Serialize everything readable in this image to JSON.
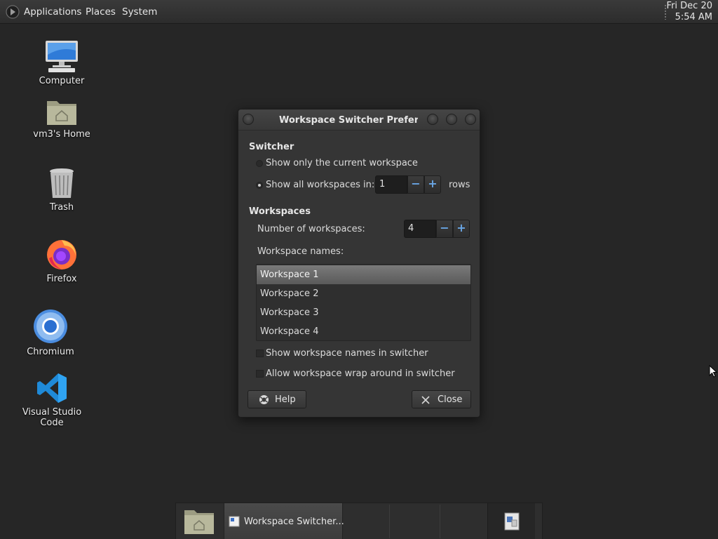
{
  "top_panel": {
    "menus": [
      "Applications",
      "Places",
      "System"
    ],
    "clock": {
      "day_date": "Fri Dec 20",
      "time": "5:54 AM"
    }
  },
  "desktop_icons": [
    {
      "label": "Computer",
      "icon": "computer-icon"
    },
    {
      "label": "vm3's Home",
      "icon": "home-folder-icon"
    },
    {
      "label": "Trash",
      "icon": "trash-icon"
    },
    {
      "label": "Firefox",
      "icon": "firefox-icon"
    },
    {
      "label": "Chromium",
      "icon": "chromium-icon"
    },
    {
      "label": "Visual Studio Code",
      "icon": "vscode-icon"
    }
  ],
  "dialog": {
    "title": "Workspace Switcher Preferences",
    "switcher_heading": "Switcher",
    "option_current_only": "Show only the current workspace",
    "option_show_all": "Show all workspaces in:",
    "option_show_all_selected": true,
    "rows_value": "1",
    "rows_suffix": "rows",
    "workspaces_heading": "Workspaces",
    "num_workspaces_label": "Number of workspaces:",
    "num_workspaces_value": "4",
    "names_label": "Workspace names:",
    "workspace_names": [
      "Workspace 1",
      "Workspace 2",
      "Workspace 3",
      "Workspace 4"
    ],
    "selected_workspace": "Workspace 1",
    "check_show_names": "Show workspace names in switcher",
    "check_wrap_around": "Allow workspace wrap around in switcher",
    "help_button": "Help",
    "close_button": "Close",
    "spin_minus": "−",
    "spin_plus": "+"
  },
  "bottom_panel": {
    "task_label": "Workspace Switcher..."
  }
}
